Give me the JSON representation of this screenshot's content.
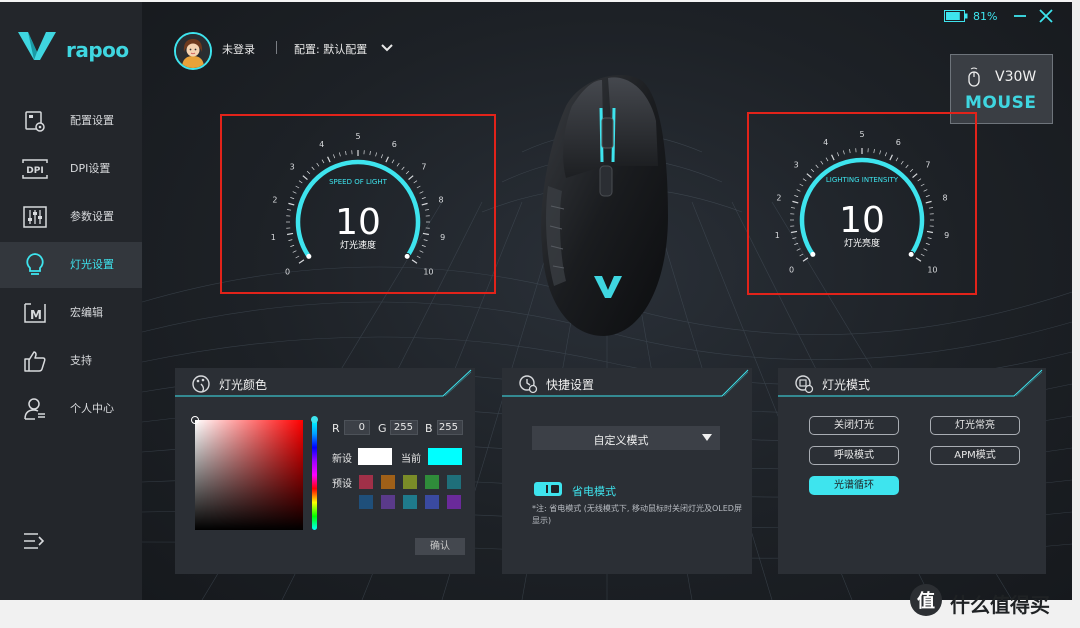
{
  "app": {
    "brand": "rapoo"
  },
  "sidebar": {
    "items": [
      {
        "label": "配置设置",
        "icon": "profile-settings-icon"
      },
      {
        "label": "DPI设置",
        "icon": "dpi-icon"
      },
      {
        "label": "参数设置",
        "icon": "sliders-icon"
      },
      {
        "label": "灯光设置",
        "icon": "bulb-icon",
        "active": true
      },
      {
        "label": "宏编辑",
        "icon": "macro-icon"
      },
      {
        "label": "支持",
        "icon": "thumbs-up-icon"
      },
      {
        "label": "个人中心",
        "icon": "user-center-icon"
      }
    ]
  },
  "header": {
    "user": "未登录",
    "config_label": "配置: 默认配置"
  },
  "status": {
    "battery": "81%",
    "battery_level": 0.81
  },
  "device": {
    "model": "V30W",
    "kind": "MOUSE"
  },
  "gauges": {
    "speed": {
      "title": "SPEED OF LIGHT",
      "value": "10",
      "label": "灯光速度",
      "ticks": [
        "0",
        "1",
        "2",
        "3",
        "4",
        "5",
        "6",
        "7",
        "8",
        "9",
        "10"
      ],
      "max": 10,
      "current": 10
    },
    "intensity": {
      "title": "LIGHTING INTENSITY",
      "value": "10",
      "label": "灯光亮度",
      "ticks": [
        "0",
        "1",
        "2",
        "3",
        "4",
        "5",
        "6",
        "7",
        "8",
        "9",
        "10"
      ],
      "max": 10,
      "current": 10
    }
  },
  "color_panel": {
    "title": "灯光颜色",
    "r_label": "R",
    "r": "0",
    "g_label": "G",
    "g": "255",
    "b_label": "B",
    "b": "255",
    "new_label": "新设",
    "current_label": "当前",
    "new_color": "#ffffff",
    "current_color": "#00ffff",
    "preset_label": "预设",
    "presets": [
      "#a03048",
      "#a06018",
      "#7a8c28",
      "#2f8c3a",
      "#1f6f7a",
      "#1f4f7a",
      "#5a3a8a",
      "#1f7a8c",
      "#3a4aa0",
      "#6a2a9a"
    ],
    "confirm": "确认"
  },
  "quick_panel": {
    "title": "快捷设置",
    "mode": "自定义模式",
    "power_saving": "省电模式",
    "note": "*注: 省电模式 (无线模式下, 移动鼠标时关闭灯光及OLED屏显示)"
  },
  "mode_panel": {
    "title": "灯光模式",
    "buttons": [
      "关闭灯光",
      "灯光常亮",
      "呼吸模式",
      "APM模式",
      "光谱循环"
    ],
    "active": "光谱循环"
  },
  "colors": {
    "accent": "#3ee4ee",
    "highlight_box": "#e2231a"
  },
  "watermark": {
    "text": "什么值得买"
  }
}
